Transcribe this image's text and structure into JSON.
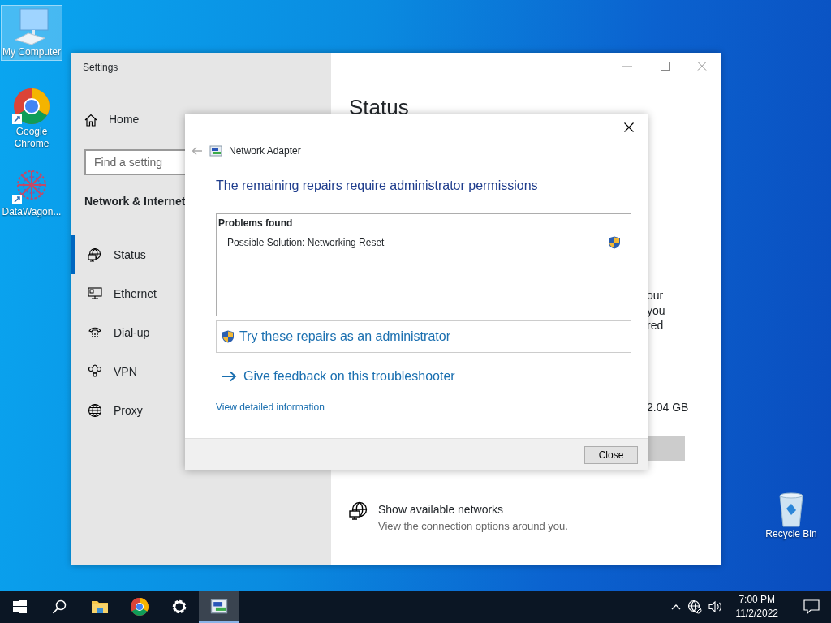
{
  "desktop_icons": [
    {
      "kind": "computer",
      "label": "My Computer",
      "selected": true
    },
    {
      "kind": "chrome",
      "label": "Google Chrome",
      "selected": false
    },
    {
      "kind": "app",
      "label": "DataWagon...",
      "selected": false
    },
    {
      "kind": "recycle",
      "label": "Recycle Bin",
      "selected": false
    }
  ],
  "settings_window": {
    "title": "Settings",
    "home": "Home",
    "search": {
      "placeholder": "Find a setting"
    },
    "section_title": "Network & Internet",
    "nav": [
      {
        "kind": "status",
        "label": "Status",
        "selected": true
      },
      {
        "kind": "ethernet",
        "label": "Ethernet",
        "selected": false
      },
      {
        "kind": "dialup",
        "label": "Dial-up",
        "selected": false
      },
      {
        "kind": "vpn",
        "label": "VPN",
        "selected": false
      },
      {
        "kind": "proxy",
        "label": "Proxy",
        "selected": false
      }
    ],
    "heading": "Status",
    "text_fragments": [
      "our",
      "you",
      "red"
    ],
    "storage_fragment": "2.04 GB",
    "show_networks": {
      "title": "Show available networks",
      "description": "View the connection options around you."
    }
  },
  "dialog": {
    "title": "Network Adapter",
    "heading": "The remaining repairs require administrator permissions",
    "problems_title": "Problems found",
    "problems": [
      {
        "label": "Possible Solution: Networking Reset",
        "needs_admin": true
      }
    ],
    "admin_button": "Try these repairs as an administrator",
    "feedback_link": "Give feedback on this troubleshooter",
    "details_link": "View detailed information",
    "close_button": "Close"
  },
  "taskbar": {
    "items": [
      {
        "kind": "start",
        "active": false
      },
      {
        "kind": "search",
        "active": false
      },
      {
        "kind": "explorer",
        "active": false
      },
      {
        "kind": "chrome",
        "active": false
      },
      {
        "kind": "settings",
        "active": false
      },
      {
        "kind": "network",
        "active": true
      }
    ],
    "time": "7:00 PM",
    "date": "11/2/2022"
  }
}
